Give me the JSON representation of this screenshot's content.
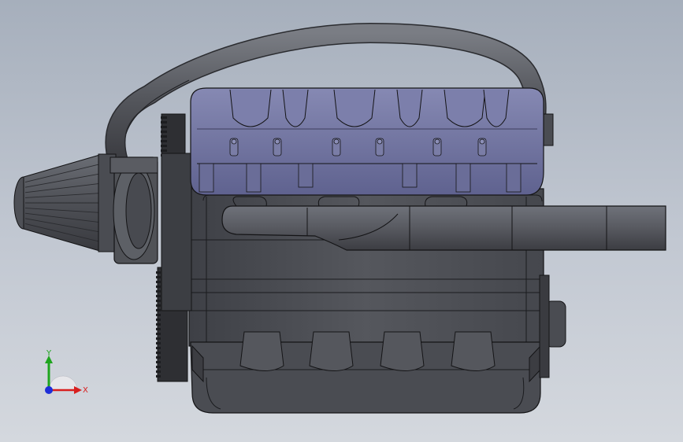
{
  "viewport": {
    "background_top": "#a6afbc",
    "background_bottom": "#d4d8de"
  },
  "model": {
    "name": "engine-assembly",
    "body_color": "#4e5056",
    "edge_color": "#141416",
    "valve_cover_color": "#6c6f9e",
    "hose_color": "#5a5c62"
  },
  "triad": {
    "x_label": "X",
    "y_label": "Y",
    "x_color": "#d81e1e",
    "y_color": "#1ea51e",
    "z_color": "#1e2ed8"
  }
}
